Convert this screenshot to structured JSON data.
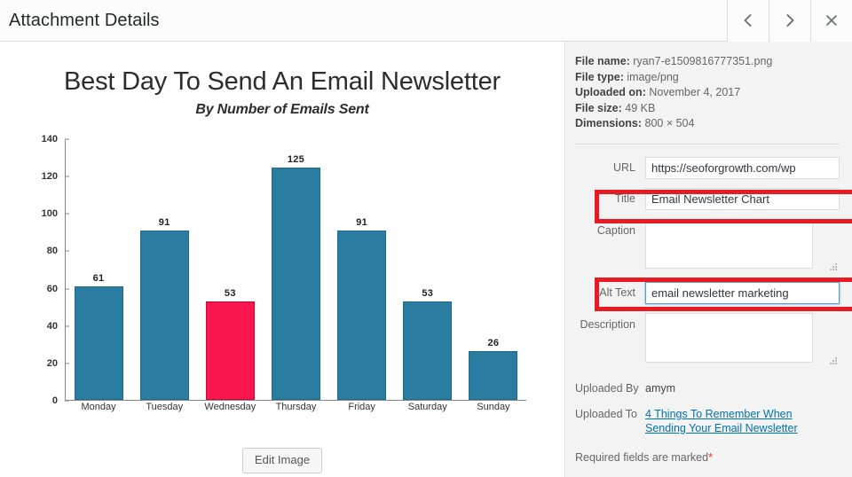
{
  "header": {
    "title": "Attachment Details",
    "prev_label": "‹",
    "next_label": "›",
    "close_label": "×"
  },
  "attachment": {
    "meta": [
      {
        "label": "File name:",
        "value": "ryan7-e1509816777351.png"
      },
      {
        "label": "File type:",
        "value": "image/png"
      },
      {
        "label": "Uploaded on:",
        "value": "November 4, 2017"
      },
      {
        "label": "File size:",
        "value": "49 KB"
      },
      {
        "label": "Dimensions:",
        "value": "800 × 504"
      }
    ],
    "fields": [
      {
        "key": "url",
        "label": "URL",
        "value": "https://seoforgrowth.com/wp",
        "type": "text",
        "focused": false,
        "readonly": true
      },
      {
        "key": "title",
        "label": "Title",
        "value": "Email Newsletter Chart",
        "type": "text",
        "focused": false,
        "readonly": false
      },
      {
        "key": "caption",
        "label": "Caption",
        "value": "",
        "type": "textarea",
        "focused": false,
        "readonly": false
      },
      {
        "key": "alt_text",
        "label": "Alt Text",
        "value": "email newsletter marketing",
        "type": "text",
        "focused": true,
        "readonly": false
      },
      {
        "key": "description",
        "label": "Description",
        "value": "",
        "type": "textarea",
        "focused": false,
        "readonly": false
      }
    ],
    "uploaded_by_label": "Uploaded By",
    "uploaded_by_value": "amym",
    "uploaded_to_label": "Uploaded To",
    "uploaded_to_link_line1": "4 Things To Remember When",
    "uploaded_to_link_line2": "Sending Your Email Newsletter",
    "required_note": "Required fields are marked",
    "required_star": "*"
  },
  "preview": {
    "edit_image_label": "Edit Image"
  },
  "colors": {
    "bar": "#2a7ca0",
    "bar_highlight": "#f8164f",
    "annotation": "#e81b23",
    "link": "#0073aa",
    "panel_bg": "#f3f3f3"
  },
  "chart_data": {
    "type": "bar",
    "title": "Best Day To Send An Email Newsletter",
    "subtitle": "By Number of Emails Sent",
    "xlabel": "",
    "ylabel": "",
    "categories": [
      "Monday",
      "Tuesday",
      "Wednesday",
      "Thursday",
      "Friday",
      "Saturday",
      "Sunday"
    ],
    "values": [
      61,
      91,
      53,
      125,
      91,
      53,
      26
    ],
    "highlight_index": 2,
    "ylim": [
      0,
      140
    ],
    "yticks": [
      0,
      20,
      40,
      60,
      80,
      100,
      120,
      140
    ],
    "grid": false,
    "legend": "none",
    "data_labels": true
  }
}
